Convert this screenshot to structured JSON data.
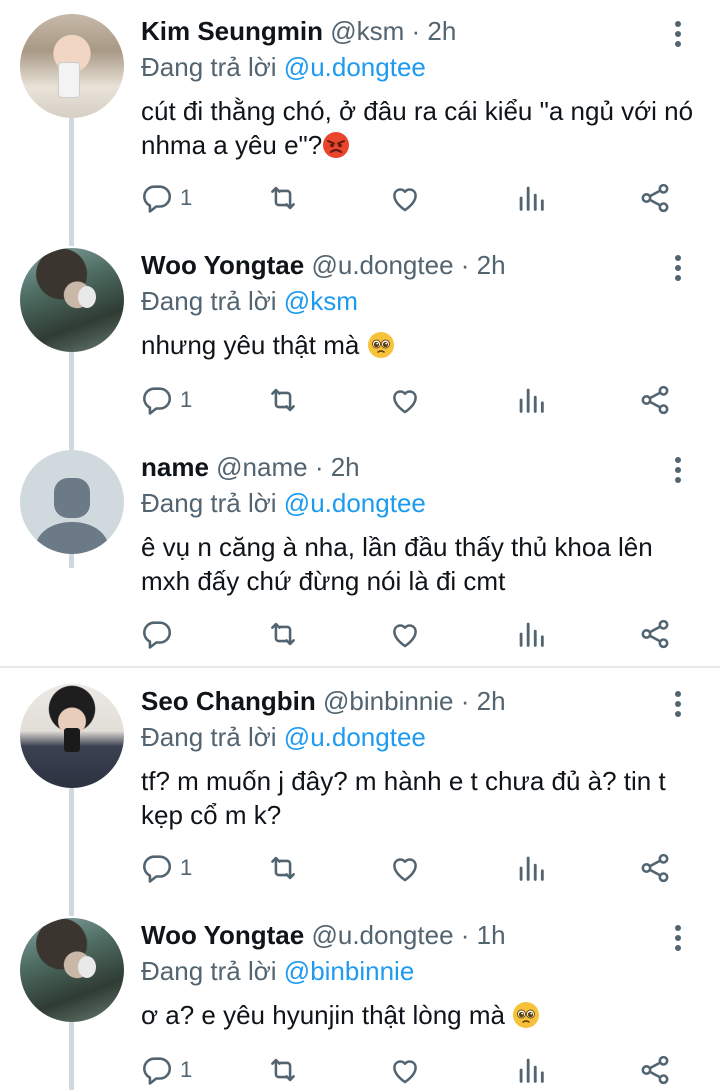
{
  "replying_prefix": "Đang trả lời",
  "tweets": [
    {
      "name": "Kim Seungmin",
      "handle": "@ksm",
      "time": "· 2h",
      "reply_to": "@u.dongtee",
      "text": "cút đi thằng chó, ở đâu ra cái kiểu \"a ngủ với nó nhma a yêu e\"?",
      "emoji": "angry-face",
      "replies": "1"
    },
    {
      "name": "Woo Yongtae",
      "handle": "@u.dongtee",
      "time": "· 2h",
      "reply_to": "@ksm",
      "text": "nhưng yêu thật mà",
      "emoji": "pleading-face",
      "replies": "1"
    },
    {
      "name": "name",
      "handle": "@name",
      "time": "· 2h",
      "reply_to": "@u.dongtee",
      "text": "ê vụ n căng à nha, lần đầu thấy thủ khoa lên mxh đấy chứ đừng nói là đi cmt",
      "emoji": "",
      "replies": ""
    },
    {
      "name": "Seo Changbin",
      "handle": "@binbinnie",
      "time": "· 2h",
      "reply_to": "@u.dongtee",
      "text": "tf? m muốn j đây? m hành e t chưa đủ à? tin t kẹp cổ m k?",
      "emoji": "",
      "replies": "1"
    },
    {
      "name": "Woo Yongtae",
      "handle": "@u.dongtee",
      "time": "· 1h",
      "reply_to": "@binbinnie",
      "text": "ơ a? e yêu hyunjin thật lòng mà",
      "emoji": "pleading-face",
      "replies": "1"
    }
  ],
  "icons": [
    "reply-icon",
    "retweet-icon",
    "like-icon",
    "analytics-icon",
    "share-icon",
    "more-icon"
  ],
  "colors": {
    "link": "#1d9bf0",
    "muted": "#536471",
    "text": "#0f1419",
    "thread_line": "#cfd9de",
    "divider": "#e7e9ea"
  }
}
